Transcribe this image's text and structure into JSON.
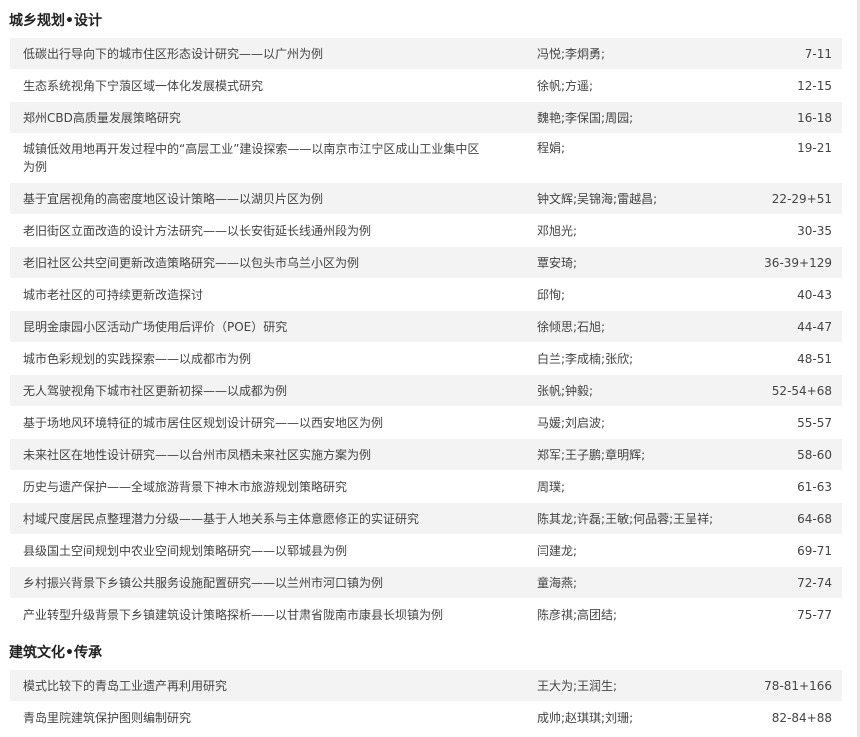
{
  "sections": [
    {
      "title": "城乡规划•设计",
      "rows": [
        {
          "title": "低碳出行导向下的城市住区形态设计研究——以广州为例",
          "authors": "冯悦;李炯勇;",
          "pages": "7-11"
        },
        {
          "title": "生态系统视角下宁蒗区域一体化发展模式研究",
          "authors": "徐帆;方遥;",
          "pages": "12-15"
        },
        {
          "title": "郑州CBD高质量发展策略研究",
          "authors": "魏艳;李保国;周园;",
          "pages": "16-18"
        },
        {
          "title": "城镇低效用地再开发过程中的“高层工业”建设探索——以南京市江宁区成山工业集中区为例",
          "authors": "程娟;",
          "pages": "19-21"
        },
        {
          "title": "基于宜居视角的高密度地区设计策略——以湖贝片区为例",
          "authors": "钟文辉;吴锦海;雷越昌;",
          "pages": "22-29+51"
        },
        {
          "title": "老旧街区立面改造的设计方法研究——以长安街延长线通州段为例",
          "authors": "邓旭光;",
          "pages": "30-35"
        },
        {
          "title": "老旧社区公共空间更新改造策略研究——以包头市乌兰小区为例",
          "authors": "覃安琦;",
          "pages": "36-39+129"
        },
        {
          "title": "城市老社区的可持续更新改造探讨",
          "authors": "邱恂;",
          "pages": "40-43"
        },
        {
          "title": "昆明金康园小区活动广场使用后评价（POE）研究",
          "authors": "徐倾思;石旭;",
          "pages": "44-47"
        },
        {
          "title": "城市色彩规划的实践探索——以成都市为例",
          "authors": "白兰;李成楠;张欣;",
          "pages": "48-51"
        },
        {
          "title": "无人驾驶视角下城市社区更新初探——以成都为例",
          "authors": "张帆;钟毅;",
          "pages": "52-54+68"
        },
        {
          "title": "基于场地风环境特征的城市居住区规划设计研究——以西安地区为例",
          "authors": "马媛;刘启波;",
          "pages": "55-57"
        },
        {
          "title": "未来社区在地性设计研究——以台州市凤栖未来社区实施方案为例",
          "authors": "郑军;王子鹏;章明辉;",
          "pages": "58-60"
        },
        {
          "title": "历史与遗产保护——全域旅游背景下神木市旅游规划策略研究",
          "authors": "周璞;",
          "pages": "61-63"
        },
        {
          "title": "村域尺度居民点整理潜力分级——基于人地关系与主体意愿修正的实证研究",
          "authors": "陈其龙;许磊;王敏;何品蓉;王呈祥;",
          "pages": "64-68"
        },
        {
          "title": "县级国土空间规划中农业空间规划策略研究——以郓城县为例",
          "authors": "闫建龙;",
          "pages": "69-71"
        },
        {
          "title": "乡村振兴背景下乡镇公共服务设施配置研究——以兰州市河口镇为例",
          "authors": "童海燕;",
          "pages": "72-74"
        },
        {
          "title": "产业转型升级背景下乡镇建筑设计策略探析——以甘肃省陇南市康县长坝镇为例",
          "authors": "陈彦祺;高团结;",
          "pages": "75-77"
        }
      ]
    },
    {
      "title": "建筑文化•传承",
      "rows": [
        {
          "title": "模式比较下的青岛工业遗产再利用研究",
          "authors": "王大为;王润生;",
          "pages": "78-81+166"
        },
        {
          "title": "青岛里院建筑保护图则编制研究",
          "authors": "成帅;赵琪琪;刘珊;",
          "pages": "82-84+88"
        }
      ]
    }
  ]
}
